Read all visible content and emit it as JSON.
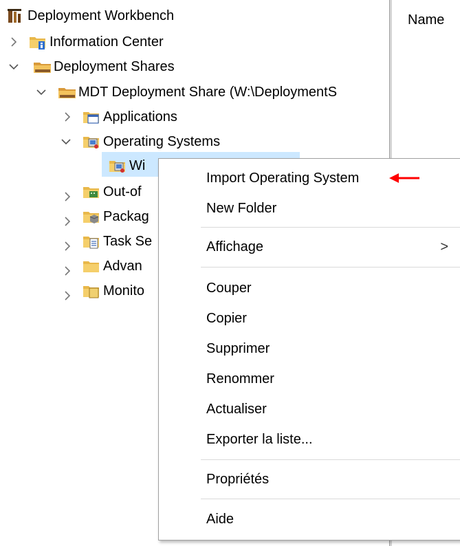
{
  "tree": {
    "root": {
      "label": "Deployment Workbench",
      "icon": "workbench-icon"
    },
    "items": [
      {
        "label": "Information Center",
        "icon": "info-folder-icon",
        "expanded": false
      },
      {
        "label": "Deployment Shares",
        "icon": "shares-folder-icon",
        "expanded": true
      },
      {
        "label": "MDT Deployment Share (W:\\DeploymentS",
        "icon": "share-folder-icon",
        "expanded": true
      },
      {
        "label": "Applications",
        "icon": "applications-folder-icon",
        "expanded": false
      },
      {
        "label": "Operating Systems",
        "icon": "os-folder-icon",
        "expanded": true
      },
      {
        "label": "Wi",
        "icon": "os-folder-icon",
        "selected": true
      },
      {
        "label": "Out-of",
        "icon": "drivers-folder-icon",
        "expanded": false
      },
      {
        "label": "Packag",
        "icon": "packages-folder-icon",
        "expanded": false
      },
      {
        "label": "Task Se",
        "icon": "tasks-folder-icon",
        "expanded": false
      },
      {
        "label": "Advan",
        "icon": "folder-icon",
        "expanded": false
      },
      {
        "label": "Monito",
        "icon": "monitor-folder-icon",
        "expanded": false
      }
    ]
  },
  "right_pane": {
    "column_header": "Name"
  },
  "context_menu": {
    "items": [
      {
        "label": "Import Operating System"
      },
      {
        "label": "New Folder"
      },
      {
        "label": "Affichage",
        "submenu_glyph": ">"
      },
      {
        "label": "Couper"
      },
      {
        "label": "Copier"
      },
      {
        "label": "Supprimer"
      },
      {
        "label": "Renommer"
      },
      {
        "label": "Actualiser"
      },
      {
        "label": "Exporter la liste..."
      },
      {
        "label": "Propriétés"
      },
      {
        "label": "Aide"
      }
    ]
  },
  "colors": {
    "selection": "#cce8ff",
    "annotation_arrow": "#ff0000",
    "folder": "#f2c35a"
  }
}
